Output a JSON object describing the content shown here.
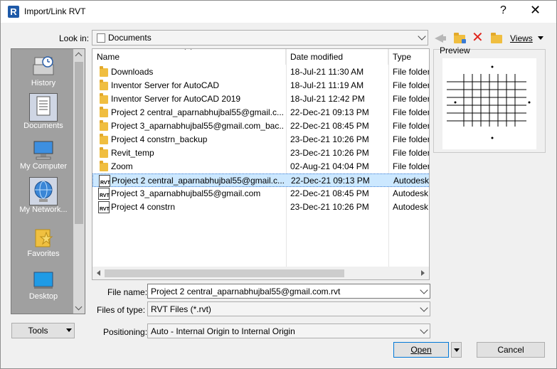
{
  "window": {
    "title": "Import/Link RVT",
    "help_label": "?",
    "close_label": "✕"
  },
  "lookin": {
    "label": "Look in:",
    "value": "Documents"
  },
  "toolbar": {
    "views_label": "Views",
    "delete_glyph": "✕"
  },
  "places": [
    {
      "label": "History",
      "icon": "history-icon"
    },
    {
      "label": "Documents",
      "icon": "documents-icon"
    },
    {
      "label": "My Computer",
      "icon": "computer-icon"
    },
    {
      "label": "My Network...",
      "icon": "network-icon"
    },
    {
      "label": "Favorites",
      "icon": "favorites-icon"
    },
    {
      "label": "Desktop",
      "icon": "desktop-icon"
    }
  ],
  "filelist": {
    "columns": [
      "Name",
      "Date modified",
      "Type"
    ],
    "rows": [
      {
        "name": "Downloads",
        "date": "18-Jul-21 11:30 AM",
        "type": "File folder",
        "kind": "folder"
      },
      {
        "name": "Inventor Server for AutoCAD",
        "date": "18-Jul-21 11:19 AM",
        "type": "File folder",
        "kind": "folder"
      },
      {
        "name": "Inventor Server for AutoCAD 2019",
        "date": "18-Jul-21 12:42 PM",
        "type": "File folder",
        "kind": "folder"
      },
      {
        "name": "Project 2 central_aparnabhujbal55@gmail.c...",
        "date": "22-Dec-21 09:13 PM",
        "type": "File folder",
        "kind": "folder"
      },
      {
        "name": "Project 3_aparnabhujbal55@gmail.com_bac...",
        "date": "22-Dec-21 08:45 PM",
        "type": "File folder",
        "kind": "folder"
      },
      {
        "name": "Project 4 constrn_backup",
        "date": "23-Dec-21 10:26 PM",
        "type": "File folder",
        "kind": "folder"
      },
      {
        "name": "Revit_temp",
        "date": "23-Dec-21 10:26 PM",
        "type": "File folder",
        "kind": "folder"
      },
      {
        "name": "Zoom",
        "date": "02-Aug-21 04:04 PM",
        "type": "File folder",
        "kind": "folder"
      },
      {
        "name": "Project 2 central_aparnabhujbal55@gmail.c...",
        "date": "22-Dec-21 09:13 PM",
        "type": "Autodesk",
        "kind": "rvt",
        "selected": true
      },
      {
        "name": "Project 3_aparnabhujbal55@gmail.com",
        "date": "22-Dec-21 08:45 PM",
        "type": "Autodesk",
        "kind": "rvt"
      },
      {
        "name": "Project 4 constrn",
        "date": "23-Dec-21 10:26 PM",
        "type": "Autodesk",
        "kind": "rvt"
      }
    ]
  },
  "preview": {
    "label": "Preview"
  },
  "form": {
    "filename_label": "File name:",
    "filename_value": "Project 2 central_aparnabhujbal55@gmail.com.rvt",
    "filetype_label": "Files of type:",
    "filetype_value": "RVT Files  (*.rvt)",
    "positioning_label": "Positioning:",
    "positioning_value": "Auto - Internal Origin to Internal Origin"
  },
  "buttons": {
    "tools": "Tools",
    "open": "Open",
    "cancel": "Cancel"
  },
  "rvt_icon_text": "RVT"
}
